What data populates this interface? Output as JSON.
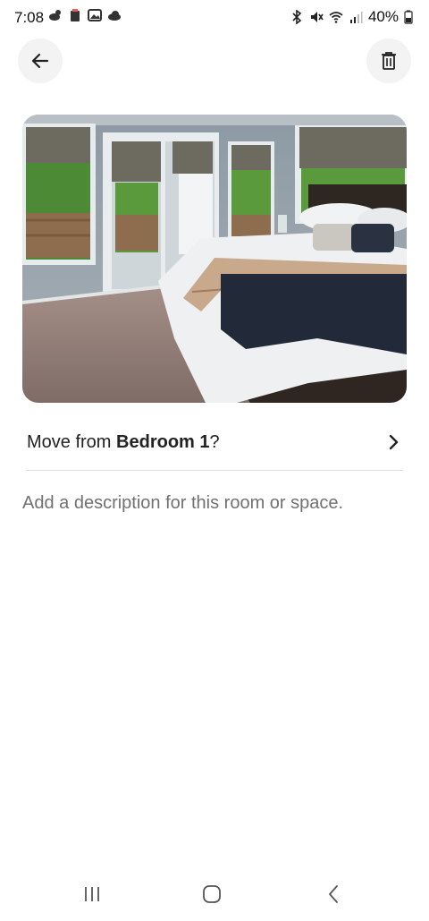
{
  "status_bar": {
    "time": "7:08",
    "battery": "40%",
    "left_icons": [
      "cloud-sun-icon",
      "app-notification-icon",
      "gallery-icon",
      "cloud-icon"
    ],
    "right_icons": [
      "bluetooth-icon",
      "mute-icon",
      "wifi-icon",
      "signal-icon",
      "battery-icon"
    ]
  },
  "header": {
    "back_icon": "arrow-left-icon",
    "delete_icon": "trash-icon"
  },
  "photo": {
    "description": "bedroom-photo"
  },
  "move_row": {
    "prefix": "Move from ",
    "room": "Bedroom 1",
    "suffix": "?",
    "chevron_icon": "chevron-right-icon"
  },
  "description": {
    "placeholder": "Add a description for this room or space."
  },
  "nav_bar": {
    "icons": [
      "recents-icon",
      "home-icon",
      "back-icon"
    ]
  }
}
